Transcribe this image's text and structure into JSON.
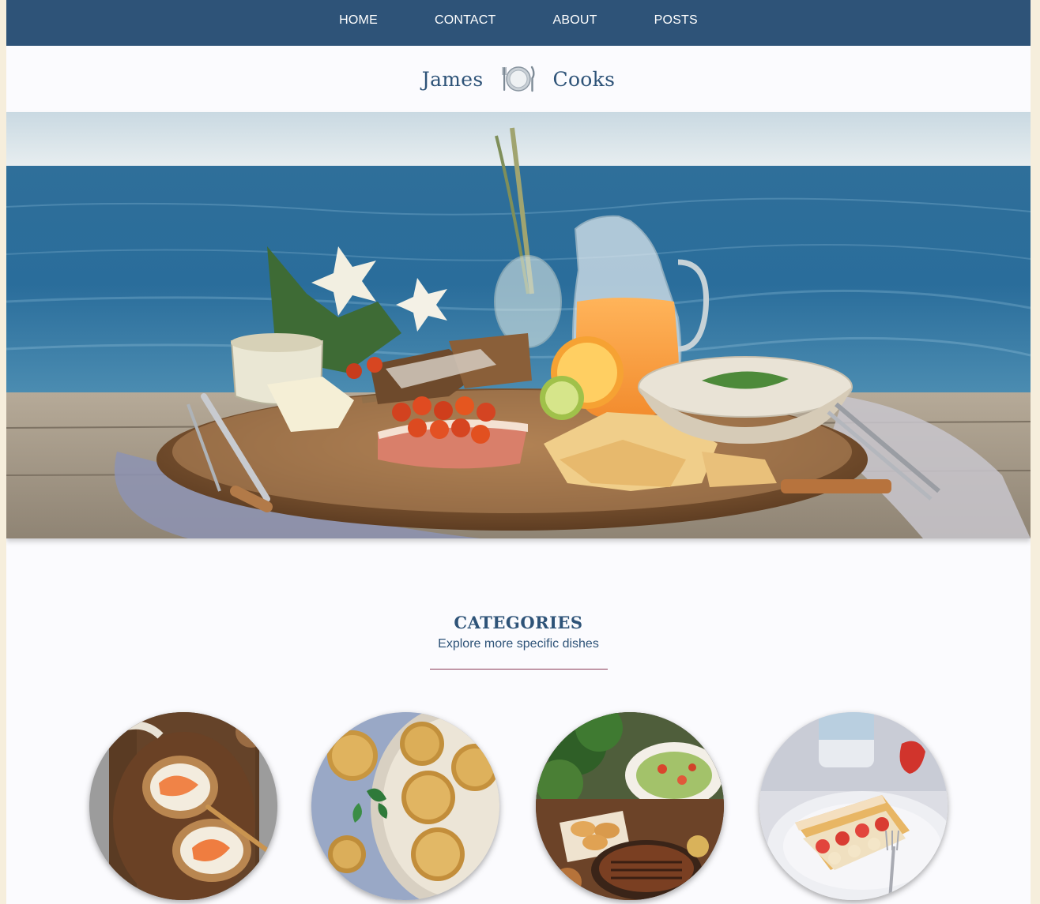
{
  "nav": {
    "items": [
      {
        "label": "HOME"
      },
      {
        "label": "CONTACT"
      },
      {
        "label": "ABOUT"
      },
      {
        "label": "POSTS"
      }
    ]
  },
  "brand": {
    "first": "James",
    "last": "Cooks",
    "icon": "plate-cutlery-icon"
  },
  "hero": {
    "image": "hero-seaside-breakfast-image"
  },
  "categories": {
    "title": "CATEGORIES",
    "subtitle": "Explore more specific dishes",
    "items": [
      {
        "image": "salmon-toast-image"
      },
      {
        "image": "bread-rolls-image"
      },
      {
        "image": "grill-feast-image"
      },
      {
        "image": "strawberry-pastry-image"
      }
    ]
  },
  "colors": {
    "nav_bg": "#2e5378",
    "brand_text": "#2e5378",
    "page_bg": "#fbfbfe",
    "body_bg": "#f6eedc",
    "divider": "#8a3a55"
  }
}
